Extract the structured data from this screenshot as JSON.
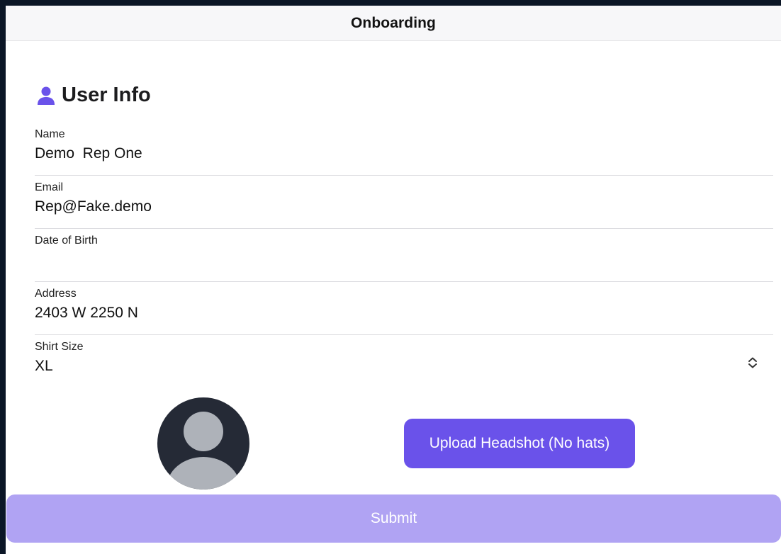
{
  "navbar": {
    "title": "Onboarding"
  },
  "section": {
    "title": "User Info",
    "icon": "person-icon",
    "icon_color": "#6a52ea"
  },
  "fields": {
    "name": {
      "label": "Name",
      "value": "Demo  Rep One"
    },
    "email": {
      "label": "Email",
      "value": "Rep@Fake.demo"
    },
    "dob": {
      "label": "Date of Birth",
      "value": ""
    },
    "address": {
      "label": "Address",
      "value": "2403 W 2250 N"
    },
    "shirt_size": {
      "label": "Shirt Size",
      "value": "XL",
      "icon": "chevron-up-down-icon"
    }
  },
  "headshot": {
    "avatar_icon": "person-silhouette-icon",
    "upload_label": "Upload Headshot (No hats)"
  },
  "submit": {
    "label": "Submit"
  },
  "colors": {
    "accent": "#6a52ea",
    "submit_disabled": "#b0a3f3",
    "background": "#0b1626"
  }
}
